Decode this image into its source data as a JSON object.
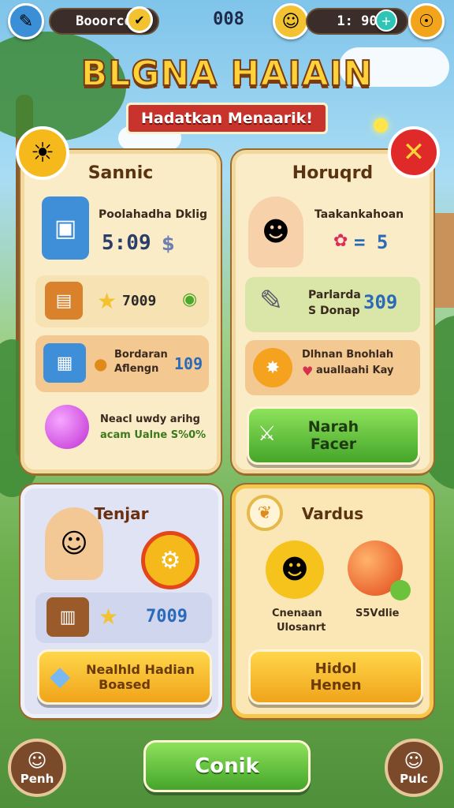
{
  "topbar": {
    "left_pill": "Booorcd",
    "center_value": "008",
    "right_pill": "1: 90"
  },
  "title": "BLGNA HAIAIN",
  "subtitle": "Hadatkan Menaarik!",
  "panels": {
    "top_left": {
      "title": "Sannic",
      "row1_text": "Poolahadha Dklig",
      "row1_value": "5:09",
      "row2_value": "7009",
      "row3_text1": "Bordaran",
      "row3_text2": "Aflengn",
      "row3_value": "109",
      "row4_text1": "Neacl uwdy arihg",
      "row4_text2": "acam Ualne S%0%"
    },
    "top_right": {
      "title": "Horuqrd",
      "row1_text": "Taakankahoan",
      "row1_value": "= 5",
      "row2_text1": "Parlarda",
      "row2_text2": "S Donap",
      "row2_value": "309",
      "row3_text1": "Dlhnan Bnohlah",
      "row3_text2": "auallaahi Kay",
      "button_line1": "Narah",
      "button_line2": "Facer"
    },
    "bottom_left": {
      "title": "Tenjar",
      "row_value": "7009",
      "button_line1": "Nealhld Hadian",
      "button_line2": "Boased"
    },
    "bottom_right": {
      "title": "Vardus",
      "label1_line1": "Cnenaan",
      "label1_line2": "Ulosanrt",
      "label2": "S5Vdlie",
      "button_line1": "Hidol",
      "button_line2": "Henen"
    }
  },
  "bottom": {
    "main_button": "Conik",
    "left_avatar": "Penh",
    "right_avatar": "Pulc"
  },
  "colors": {
    "accent_green": "#45a52a",
    "accent_yellow": "#f0a41a",
    "panel_bg": "#fbecc8",
    "ribbon_red": "#c8342b"
  }
}
